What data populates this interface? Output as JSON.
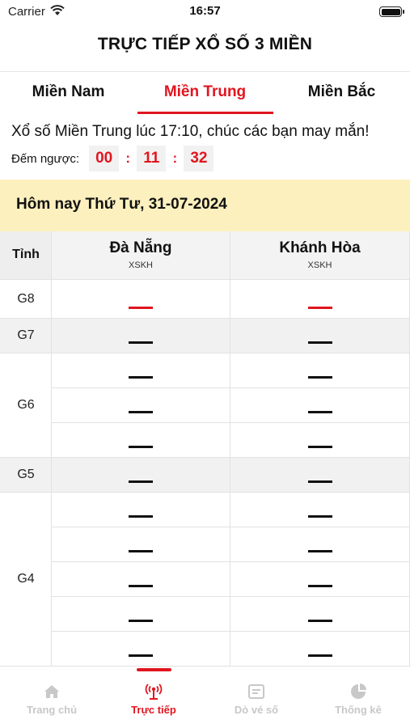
{
  "status_bar": {
    "carrier": "Carrier",
    "time": "16:57"
  },
  "title": "TRỰC TIẾP XỔ SỐ 3 MIỀN",
  "tabs": [
    {
      "label": "Miền Nam",
      "active": false
    },
    {
      "label": "Miền Trung",
      "active": true
    },
    {
      "label": "Miền Bắc",
      "active": false
    }
  ],
  "info": "Xổ số Miền Trung lúc 17:10, chúc các bạn may mắn!",
  "countdown": {
    "label": "Đếm ngược:",
    "hours": "00",
    "minutes": "11",
    "seconds": "32",
    "separator": ":"
  },
  "date_banner": "Hôm nay Thứ Tư, 31-07-2024",
  "table": {
    "header_label": "Tỉnh",
    "provinces": [
      {
        "name": "Đà Nẵng",
        "code": "XSKH"
      },
      {
        "name": "Khánh Hòa",
        "code": "XSKH"
      }
    ],
    "prizes": [
      {
        "label": "G8",
        "rows": 1,
        "highlight": "red"
      },
      {
        "label": "G7",
        "rows": 1,
        "highlight": "none"
      },
      {
        "label": "G6",
        "rows": 3,
        "highlight": "none"
      },
      {
        "label": "G5",
        "rows": 1,
        "highlight": "none"
      },
      {
        "label": "G4",
        "rows": 5,
        "highlight": "none"
      }
    ],
    "pending_result": "—"
  },
  "tab_bar": [
    {
      "label": "Trang chủ",
      "icon": "home-icon",
      "active": false
    },
    {
      "label": "Trực tiếp",
      "icon": "live-broadcast-icon",
      "active": true
    },
    {
      "label": "Dò vé số",
      "icon": "ticket-check-icon",
      "active": false
    },
    {
      "label": "Thống kê",
      "icon": "pie-chart-icon",
      "active": false
    }
  ],
  "colors": {
    "accent": "#e0161f",
    "banner": "#fcf0be",
    "inactive": "#c8c8c8"
  }
}
